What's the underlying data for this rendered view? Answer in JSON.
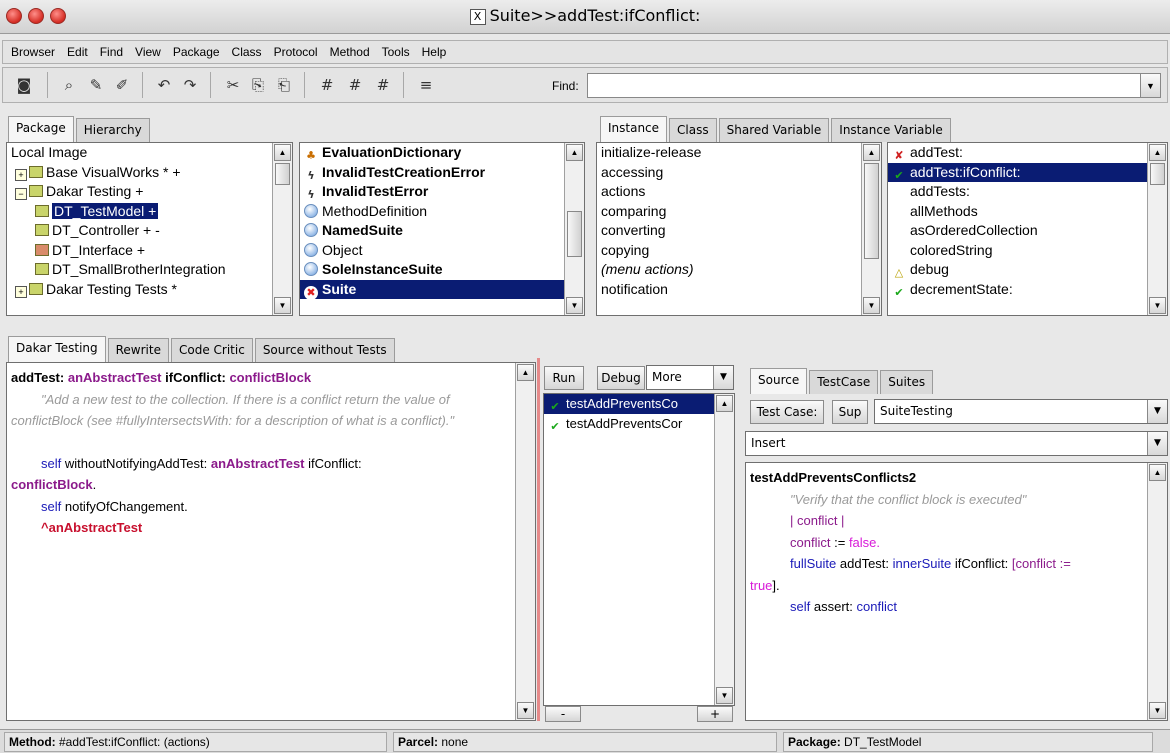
{
  "window": {
    "title": "Suite>>addTest:ifConflict:"
  },
  "menu": [
    "Browser",
    "Edit",
    "Find",
    "View",
    "Package",
    "Class",
    "Protocol",
    "Method",
    "Tools",
    "Help"
  ],
  "toolbar": {
    "find_label": "Find:",
    "find_value": ""
  },
  "package_pane": {
    "tabs": [
      "Package",
      "Hierarchy"
    ],
    "items": [
      {
        "label": "Local Image",
        "indent": 0,
        "icon": "none"
      },
      {
        "label": "Base VisualWorks * +",
        "indent": 1,
        "icon": "package-icon"
      },
      {
        "label": "Dakar Testing +",
        "indent": 1,
        "icon": "package-icon"
      },
      {
        "label": "DT_TestModel +",
        "indent": 2,
        "icon": "test-model-icon",
        "selected": true
      },
      {
        "label": "DT_Controller + -",
        "indent": 2,
        "icon": "test-pass-icon"
      },
      {
        "label": "DT_Interface +",
        "indent": 2,
        "icon": "test-fail-icon"
      },
      {
        "label": "DT_SmallBrotherIntegration",
        "indent": 2,
        "icon": "package-icon"
      },
      {
        "label": "Dakar Testing Tests *",
        "indent": 1,
        "icon": "package-icon"
      }
    ]
  },
  "class_pane": {
    "items": [
      {
        "label": "EvaluationDictionary",
        "bold": true,
        "icon": "dictionary-icon"
      },
      {
        "label": "InvalidTestCreationError",
        "bold": true,
        "icon": "lightning-icon"
      },
      {
        "label": "InvalidTestError",
        "bold": true,
        "icon": "lightning-icon"
      },
      {
        "label": "MethodDefinition",
        "bold": false,
        "icon": "class-icon"
      },
      {
        "label": "NamedSuite",
        "bold": true,
        "icon": "class-icon"
      },
      {
        "label": "Object",
        "bold": false,
        "icon": "class-icon"
      },
      {
        "label": "SoleInstanceSuite",
        "bold": true,
        "icon": "class-icon"
      },
      {
        "label": "Suite",
        "bold": true,
        "icon": "class-fail-icon",
        "selected": true
      }
    ]
  },
  "protocol_pane": {
    "tabs": [
      "Instance",
      "Class",
      "Shared Variable",
      "Instance Variable"
    ],
    "items": [
      "initialize-release",
      "accessing",
      "actions",
      "comparing",
      "converting",
      "copying",
      "(menu actions)",
      "notification"
    ]
  },
  "method_pane": {
    "items": [
      {
        "label": "addTest:",
        "icon": "fail-pass-icon"
      },
      {
        "label": "addTest:ifConflict:",
        "icon": "pass-icon",
        "selected": true
      },
      {
        "label": "addTests:",
        "icon": "none"
      },
      {
        "label": "allMethods",
        "icon": "none"
      },
      {
        "label": "asOrderedCollection",
        "icon": "none"
      },
      {
        "label": "coloredString",
        "icon": "none"
      },
      {
        "label": "debug",
        "icon": "warning-icon"
      },
      {
        "label": "decrementState:",
        "icon": "pass-icon"
      }
    ]
  },
  "editor": {
    "tabs": [
      "Dakar Testing",
      "Rewrite",
      "Code Critic",
      "Source without Tests"
    ],
    "sig_sel1": "addTest:",
    "sig_arg1": "anAbstractTest",
    "sig_sel2": "ifConflict:",
    "sig_arg2": "conflictBlock",
    "comment": "\"Add a new test to the collection. If there is a conflict return the value of conflictBlock (see #fullyIntersectsWith: for a description of what is a conflict).\"",
    "l1_self": "self",
    "l1_a": "withoutNotifyingAddTest:",
    "l1_b": "anAbstractTest",
    "l1_c": "ifConflict:",
    "l2_b": "conflictBlock",
    "l2_dot": ".",
    "l3_self": "self",
    "l3_a": "notifyOfChangement.",
    "l4": "^anAbstractTest"
  },
  "test_pane": {
    "run": "Run",
    "debug": "Debug",
    "more": "More",
    "items": [
      "testAddPreventsCo",
      "testAddPreventsCor"
    ],
    "minus": "-",
    "plus": "+"
  },
  "test_source": {
    "tabs": [
      "Source",
      "TestCase",
      "Suites"
    ],
    "test_case_label": "Test Case:",
    "sup_label": "Sup",
    "test_case_value": "SuiteTesting",
    "insert_value": "Insert",
    "method_name": "testAddPreventsConflicts2",
    "comment": "\"Verify that the conflict block is executed\"",
    "l1": "| conflict |",
    "l2_a": "conflict",
    "l2_b": ":=",
    "l2_c": "false.",
    "l3_a": "fullSuite",
    "l3_b": "addTest:",
    "l3_c": "innerSuite",
    "l3_d": "ifConflict:",
    "l3_e": "[conflict :=",
    "l4_a": "true",
    "l4_b": "].",
    "l5_a": "self",
    "l5_b": "assert:",
    "l5_c": "conflict"
  },
  "status": {
    "method_label": "Method:",
    "method_value": "#addTest:ifConflict: (actions)",
    "parcel_label": "Parcel:",
    "parcel_value": "none",
    "package_label": "Package:",
    "package_value": "DT_TestModel"
  }
}
